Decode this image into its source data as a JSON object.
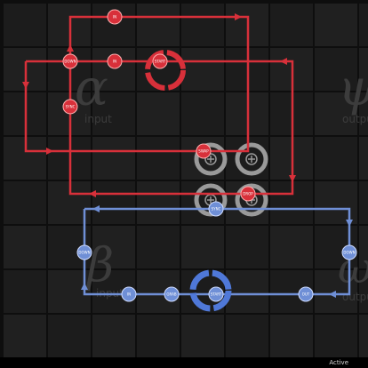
{
  "zones": [
    {
      "letter": "α",
      "label": "input"
    },
    {
      "letter": "ψ",
      "label": "output"
    },
    {
      "letter": "β",
      "label": "input"
    },
    {
      "letter": "ω",
      "label": "output"
    }
  ],
  "red_nodes": [
    {
      "text": "IN"
    },
    {
      "text": "DOWN"
    },
    {
      "text": "IN"
    },
    {
      "text": "SYNC"
    },
    {
      "text": "START"
    },
    {
      "text": "SWAP"
    },
    {
      "text": "DROP"
    }
  ],
  "blue_nodes": [
    {
      "text": "DOWN"
    },
    {
      "text": "GRAB"
    },
    {
      "text": "DOWN"
    },
    {
      "text": "IN"
    },
    {
      "text": "SYNC"
    },
    {
      "text": "START"
    },
    {
      "text": "OUT"
    }
  ],
  "status": {
    "text": "Active"
  },
  "colors": {
    "red_track": "#d8303a",
    "blue_track": "#6f8fd6",
    "gray_reactor": "#9a9a9a",
    "grid_line": "#1a1a1a",
    "tile": "#1f1f1f"
  },
  "icons": {
    "bond": "plus-circle-icon",
    "start": "ring-icon"
  }
}
